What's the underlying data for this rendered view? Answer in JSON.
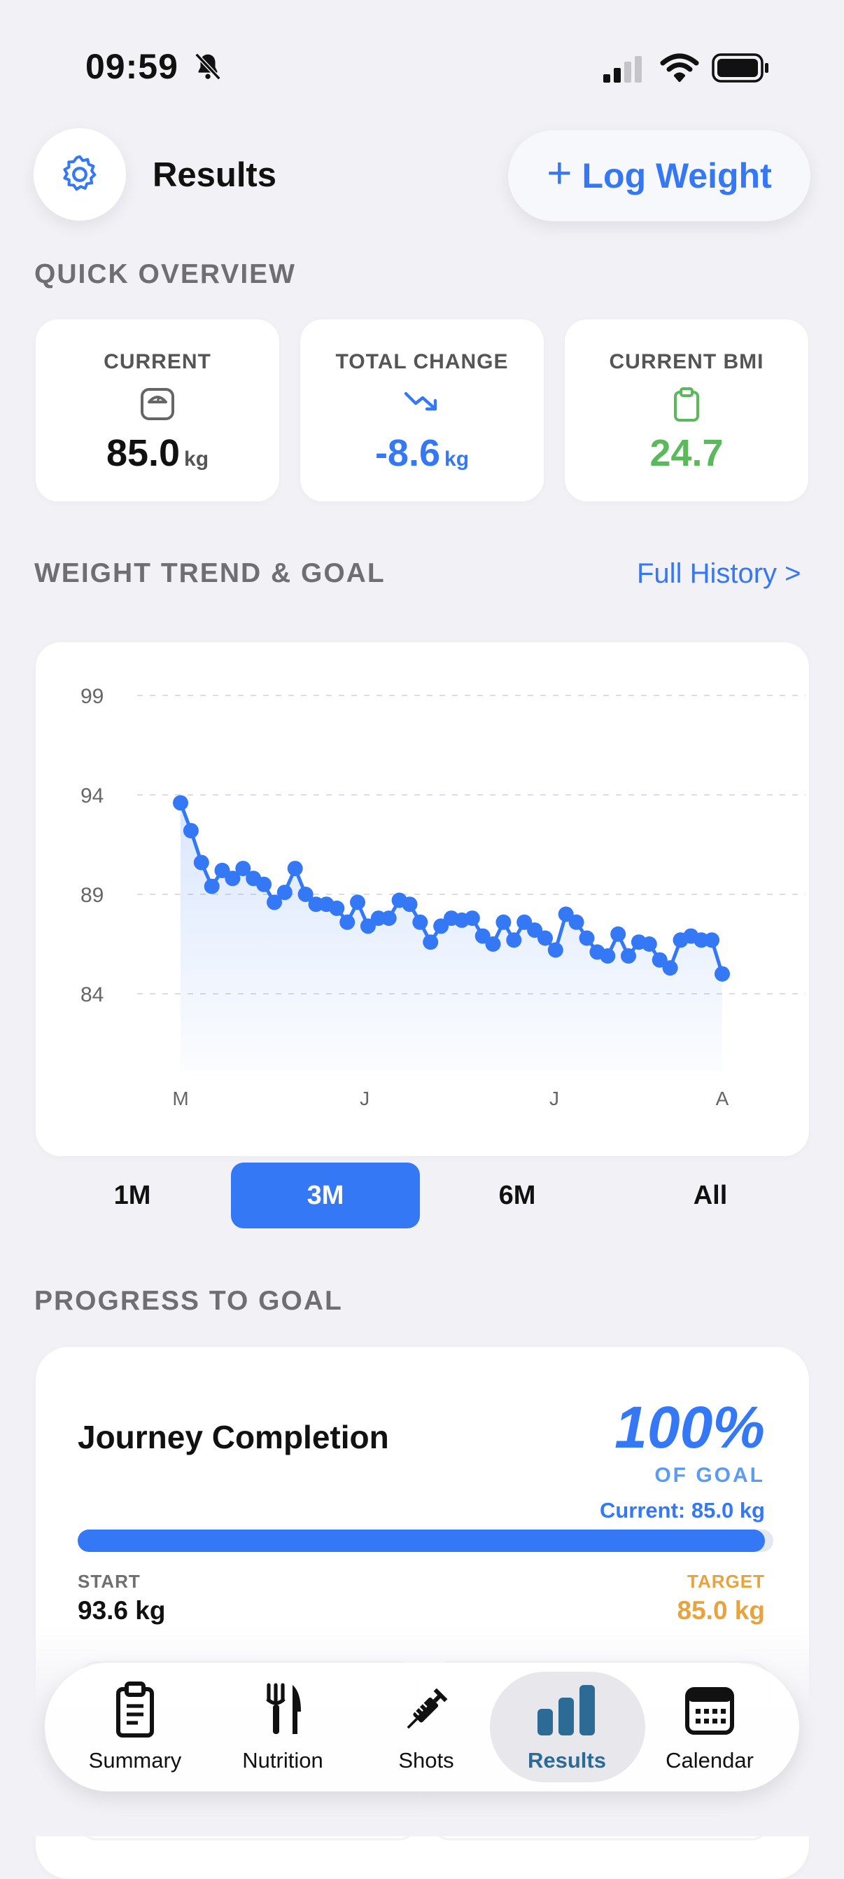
{
  "status_bar": {
    "time": "09:59"
  },
  "header": {
    "title": "Results",
    "log_button": "Log Weight",
    "log_button_plus": "+"
  },
  "overview": {
    "label": "QUICK OVERVIEW",
    "cards": [
      {
        "title": "CURRENT",
        "value": "85.0",
        "unit": "kg",
        "icon": "scale-icon",
        "color": "#111111"
      },
      {
        "title": "TOTAL CHANGE",
        "value": "-8.6",
        "unit": "kg",
        "icon": "trend-down-icon",
        "color": "#3478f6"
      },
      {
        "title": "CURRENT BMI",
        "value": "24.7",
        "unit": "",
        "icon": "clipboard-icon",
        "color": "#5cb85c"
      }
    ]
  },
  "trend": {
    "label": "WEIGHT TREND & GOAL",
    "history_link": "Full History >"
  },
  "chart_data": {
    "type": "line",
    "y_ticks": [
      "99",
      "94",
      "89",
      "84"
    ],
    "x_ticks": [
      "M",
      "J",
      "J",
      "A"
    ],
    "ylim": [
      79,
      100
    ],
    "grid": true,
    "line_color": "#3478f6",
    "series": [
      {
        "values": [
          93.6,
          92.2,
          90.6,
          89.4,
          90.2,
          89.8,
          90.3,
          89.8,
          89.5,
          88.6,
          89.1,
          90.3,
          89.0,
          88.5,
          88.5,
          88.3,
          87.6,
          88.6,
          87.4,
          87.8,
          87.8,
          88.7,
          88.5,
          87.6,
          86.6,
          87.4,
          87.8,
          87.7,
          87.8,
          86.9,
          86.5,
          87.6,
          86.7,
          87.6,
          87.2,
          86.8,
          86.2,
          88.0,
          87.6,
          86.8,
          86.1,
          85.9,
          87.0,
          85.9,
          86.6,
          86.5,
          85.7,
          85.3,
          86.7,
          86.9,
          86.7,
          86.7,
          85.0
        ]
      }
    ]
  },
  "ranges": {
    "items": [
      "1M",
      "3M",
      "6M",
      "All"
    ],
    "active": "3M"
  },
  "progress": {
    "label": "PROGRESS TO GOAL",
    "title": "Journey Completion",
    "percent": "100%",
    "percent_value": 1.0,
    "of_goal": "OF GOAL",
    "current": "Current: 85.0 kg",
    "start_label": "START",
    "start_value": "93.6 kg",
    "target_label": "TARGET",
    "target_value": "85.0 kg"
  },
  "tabbar": {
    "items": [
      {
        "label": "Summary",
        "icon": "clipboard-list-icon"
      },
      {
        "label": "Nutrition",
        "icon": "fork-knife-icon"
      },
      {
        "label": "Shots",
        "icon": "syringe-icon"
      },
      {
        "label": "Results",
        "icon": "bar-chart-icon"
      },
      {
        "label": "Calendar",
        "icon": "calendar-icon"
      }
    ],
    "active": "Results"
  },
  "colors": {
    "accent": "#3478f6",
    "target": "#e8a33c",
    "bmi": "#5cb85c",
    "background": "#f1f1f6"
  }
}
